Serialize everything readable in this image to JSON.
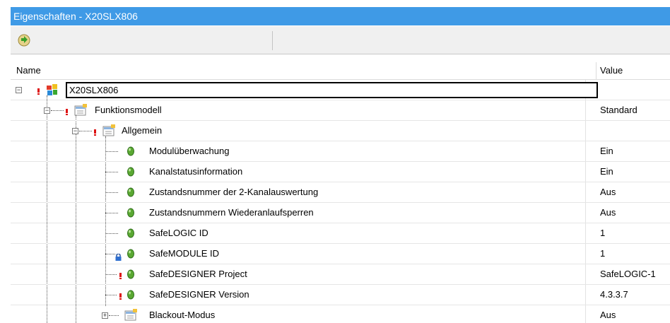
{
  "window": {
    "title": "Eigenschaften - X20SLX806"
  },
  "header": {
    "name": "Name",
    "value": "Value"
  },
  "rows": [
    {
      "label": "X20SLX806",
      "value": ""
    },
    {
      "label": "Funktionsmodell",
      "value": "Standard"
    },
    {
      "label": "Allgemein",
      "value": ""
    },
    {
      "label": "Modulüberwachung",
      "value": "Ein"
    },
    {
      "label": "Kanalstatusinformation",
      "value": "Ein"
    },
    {
      "label": "Zustandsnummer der 2-Kanalauswertung",
      "value": "Aus"
    },
    {
      "label": "Zustandsnummern Wiederanlaufsperren",
      "value": "Aus"
    },
    {
      "label": "SafeLOGIC ID",
      "value": "1"
    },
    {
      "label": "SafeMODULE ID",
      "value": "1"
    },
    {
      "label": "SafeDESIGNER Project",
      "value": "SafeLOGIC-1"
    },
    {
      "label": "SafeDESIGNER Version",
      "value": "4.3.3.7"
    },
    {
      "label": "Blackout-Modus",
      "value": "Aus"
    }
  ],
  "icons": {
    "toolbar": "refresh-arrow-icon",
    "root": "module-icon",
    "group": "property-group-icon",
    "param": "green-bullet-icon",
    "lock": "lock-icon",
    "warning": "warning-marker-icon"
  },
  "colors": {
    "titlebar": "#3f9ae6",
    "bullet": "#5aa832",
    "warning": "#dd1111"
  }
}
